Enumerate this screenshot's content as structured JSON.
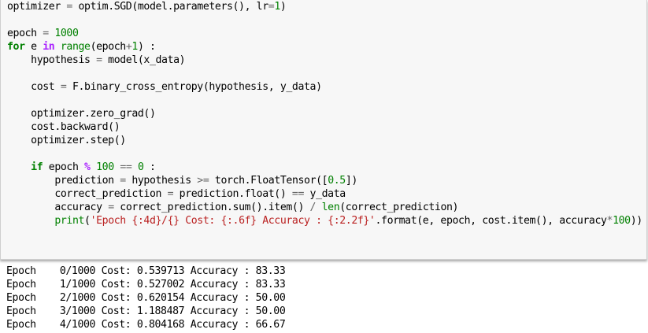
{
  "code_cell": {
    "lines": [
      [
        {
          "t": "optimizer ",
          "c": "txt"
        },
        {
          "t": "=",
          "c": "opn"
        },
        {
          "t": " optim.SGD(model.parameters(), lr",
          "c": "txt"
        },
        {
          "t": "=",
          "c": "opn"
        },
        {
          "t": "1",
          "c": "num"
        },
        {
          "t": ")",
          "c": "txt"
        }
      ],
      [],
      [
        {
          "t": "epoch ",
          "c": "txt"
        },
        {
          "t": "=",
          "c": "opn"
        },
        {
          "t": " ",
          "c": "txt"
        },
        {
          "t": "1000",
          "c": "num"
        }
      ],
      [
        {
          "t": "for",
          "c": "kw"
        },
        {
          "t": " e ",
          "c": "txt"
        },
        {
          "t": "in",
          "c": "op"
        },
        {
          "t": " ",
          "c": "txt"
        },
        {
          "t": "range",
          "c": "bi"
        },
        {
          "t": "(epoch",
          "c": "txt"
        },
        {
          "t": "+",
          "c": "opn"
        },
        {
          "t": "1",
          "c": "num"
        },
        {
          "t": ") :",
          "c": "txt"
        }
      ],
      [
        {
          "t": "    hypothesis ",
          "c": "txt"
        },
        {
          "t": "=",
          "c": "opn"
        },
        {
          "t": " model(x_data)",
          "c": "txt"
        }
      ],
      [],
      [
        {
          "t": "    cost ",
          "c": "txt"
        },
        {
          "t": "=",
          "c": "opn"
        },
        {
          "t": " F.binary_cross_entropy(hypothesis, y_data)",
          "c": "txt"
        }
      ],
      [],
      [
        {
          "t": "    optimizer.zero_grad()",
          "c": "txt"
        }
      ],
      [
        {
          "t": "    cost.backward()",
          "c": "txt"
        }
      ],
      [
        {
          "t": "    optimizer.step()",
          "c": "txt"
        }
      ],
      [],
      [
        {
          "t": "    ",
          "c": "txt"
        },
        {
          "t": "if",
          "c": "kw"
        },
        {
          "t": " epoch ",
          "c": "txt"
        },
        {
          "t": "%",
          "c": "op"
        },
        {
          "t": " ",
          "c": "txt"
        },
        {
          "t": "100",
          "c": "num"
        },
        {
          "t": " ",
          "c": "txt"
        },
        {
          "t": "==",
          "c": "opn"
        },
        {
          "t": " ",
          "c": "txt"
        },
        {
          "t": "0",
          "c": "num"
        },
        {
          "t": " :",
          "c": "txt"
        }
      ],
      [
        {
          "t": "        prediction ",
          "c": "txt"
        },
        {
          "t": "=",
          "c": "opn"
        },
        {
          "t": " hypothesis ",
          "c": "txt"
        },
        {
          "t": ">=",
          "c": "opn"
        },
        {
          "t": " torch.FloatTensor([",
          "c": "txt"
        },
        {
          "t": "0.5",
          "c": "num"
        },
        {
          "t": "])",
          "c": "txt"
        }
      ],
      [
        {
          "t": "        correct_prediction ",
          "c": "txt"
        },
        {
          "t": "=",
          "c": "opn"
        },
        {
          "t": " prediction.float() ",
          "c": "txt"
        },
        {
          "t": "==",
          "c": "opn"
        },
        {
          "t": " y_data",
          "c": "txt"
        }
      ],
      [
        {
          "t": "        accuracy ",
          "c": "txt"
        },
        {
          "t": "=",
          "c": "opn"
        },
        {
          "t": " correct_prediction.sum().item() ",
          "c": "txt"
        },
        {
          "t": "/",
          "c": "opn"
        },
        {
          "t": " ",
          "c": "txt"
        },
        {
          "t": "len",
          "c": "bi"
        },
        {
          "t": "(correct_prediction)",
          "c": "txt"
        }
      ],
      [
        {
          "t": "        ",
          "c": "txt"
        },
        {
          "t": "print",
          "c": "bi"
        },
        {
          "t": "(",
          "c": "txt"
        },
        {
          "t": "'Epoch {:4d}/{} Cost: {:.6f} Accuracy : {:2.2f}'",
          "c": "str"
        },
        {
          "t": ".format(e, epoch, cost.item(), accuracy",
          "c": "txt"
        },
        {
          "t": "*",
          "c": "opn"
        },
        {
          "t": "100",
          "c": "num"
        },
        {
          "t": "))",
          "c": "txt"
        }
      ]
    ]
  },
  "output": {
    "lines": [
      "Epoch    0/1000 Cost: 0.539713 Accuracy : 83.33",
      "Epoch    1/1000 Cost: 0.527002 Accuracy : 83.33",
      "Epoch    2/1000 Cost: 0.620154 Accuracy : 50.00",
      "Epoch    3/1000 Cost: 1.188487 Accuracy : 50.00",
      "Epoch    4/1000 Cost: 0.804168 Accuracy : 66.67"
    ]
  }
}
